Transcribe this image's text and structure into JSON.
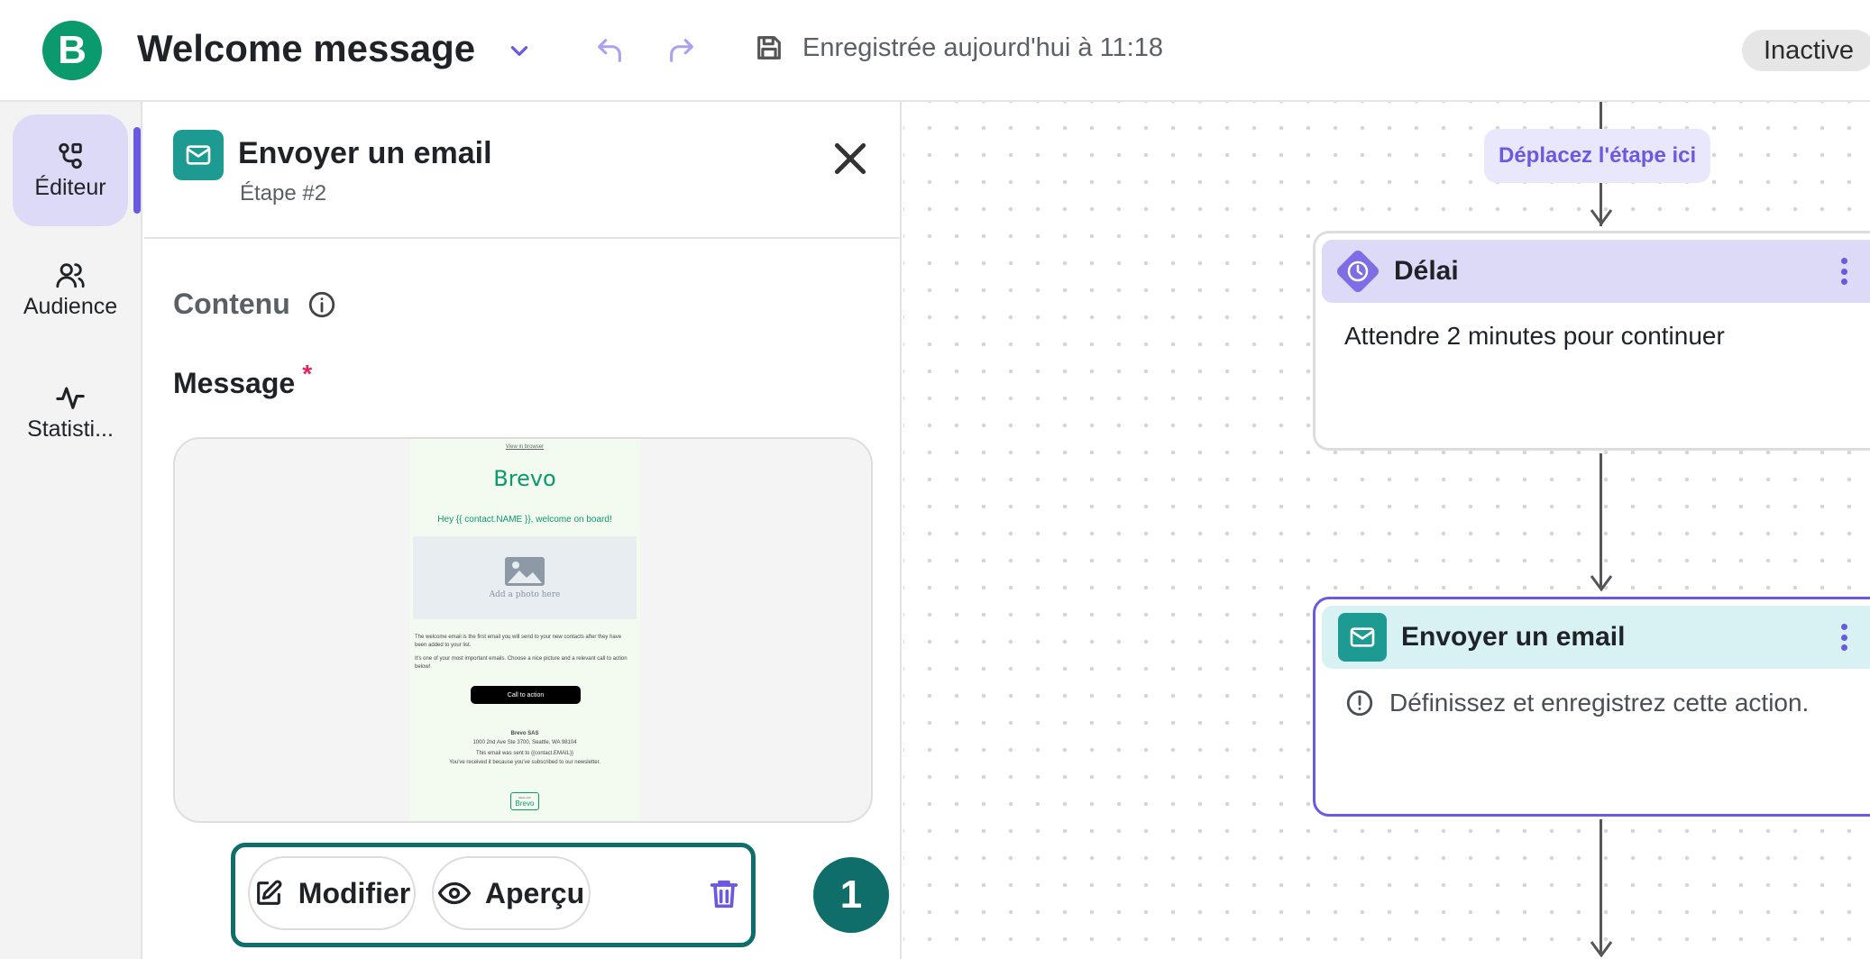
{
  "header": {
    "logo_letter": "B",
    "workflow_title": "Welcome message",
    "save_status": "Enregistrée aujourd'hui à 11:18",
    "status": "Inactive"
  },
  "leftnav": {
    "items": [
      {
        "label": "Éditeur",
        "icon": "workflow-icon",
        "active": true
      },
      {
        "label": "Audience",
        "icon": "users-icon",
        "active": false
      },
      {
        "label": "Statisti...",
        "icon": "activity-icon",
        "active": false
      }
    ]
  },
  "panel": {
    "step_title": "Envoyer un email",
    "step_subtitle": "Étape #2",
    "section_title": "Contenu",
    "message_label": "Message",
    "required_mark": "*",
    "preview": {
      "view_link": "View in browser",
      "brand": "Brevo",
      "greeting": "Hey {{ contact.NAME }}, welcome on board!",
      "photo_placeholder": "Add a photo here",
      "paragraph_1": "The welcome email is the first email you will send to your new contacts after they have been added to your list.",
      "paragraph_2": "It's one of your most important emails. Choose a nice picture and a relevant call to action below!",
      "cta": "Call to action",
      "company": "Brevo SAS",
      "address": "1000 2nd Ave Ste 3700, Seattle, WA 98104",
      "sent_to": "This email was sent to {{contact.EMAIL}}",
      "reason": "You've received it because you've subscribed to our newsletter.",
      "mini_logo_caption": "Made with",
      "mini_logo_brand": "Brevo"
    },
    "actions": {
      "edit": "Modifier",
      "preview": "Aperçu"
    },
    "badge": "1"
  },
  "canvas": {
    "drop_hint": "Déplacez l'étape ici",
    "nodes": [
      {
        "title": "Délai",
        "body": "Attendre 2 minutes pour continuer",
        "accent": "#dcdaf7"
      },
      {
        "title": "Envoyer un email",
        "body": "Définissez et enregistrez cette action.",
        "accent": "#d8f1f3"
      }
    ]
  },
  "colors": {
    "brand_green": "#0b996e",
    "accent_purple": "#6a5ae0",
    "teal": "#0f6e69"
  }
}
